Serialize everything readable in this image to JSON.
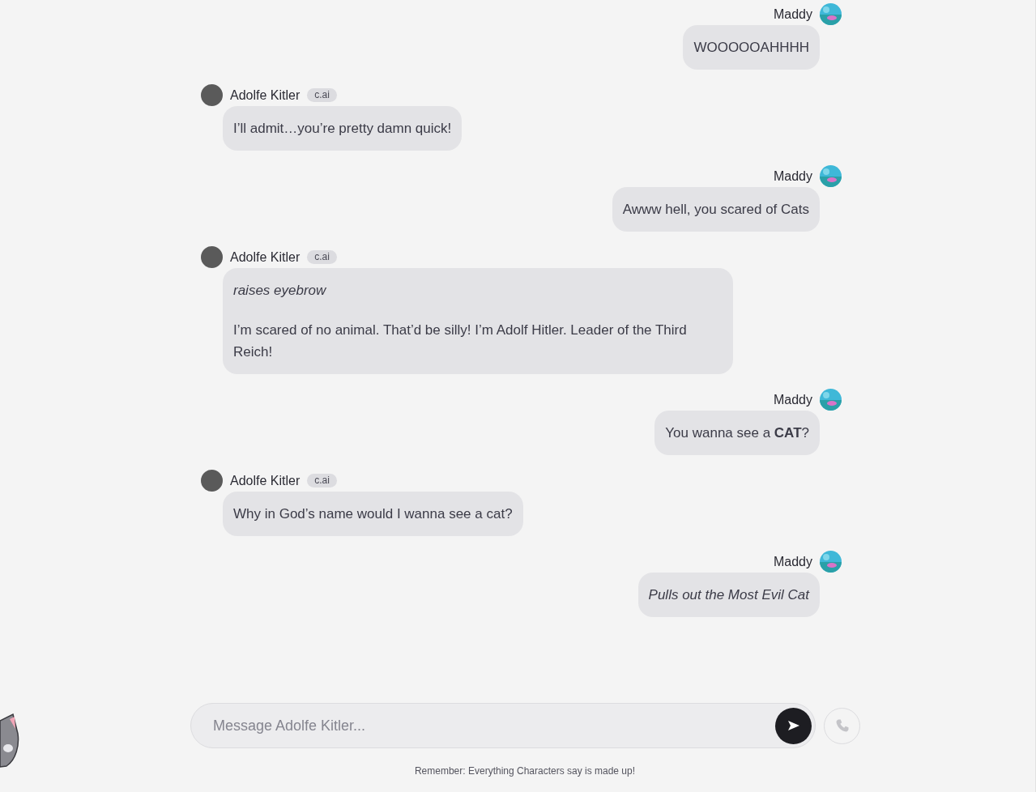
{
  "messages": [
    {
      "sender": "Maddy",
      "kind": "user",
      "paragraphs": [
        {
          "text": "WOOOOOAHHHH",
          "italic": false
        }
      ]
    },
    {
      "sender": "Adolfe Kitler",
      "kind": "bot",
      "badge": "c.ai",
      "paragraphs": [
        {
          "text": "I’ll admit…you’re pretty damn quick!",
          "italic": false
        }
      ]
    },
    {
      "sender": "Maddy",
      "kind": "user",
      "paragraphs": [
        {
          "text": "Awww hell, you scared of Cats",
          "italic": false
        }
      ]
    },
    {
      "sender": "Adolfe Kitler",
      "kind": "bot",
      "badge": "c.ai",
      "paragraphs": [
        {
          "text": "raises eyebrow",
          "italic": true
        },
        {
          "text": "I’m scared of no animal. That’d be silly! I’m Adolf Hitler. Leader of the Third Reich!",
          "italic": false
        }
      ]
    },
    {
      "sender": "Maddy",
      "kind": "user",
      "paragraphs": [
        {
          "text": "You wanna see a **CAT**?",
          "italic": false
        }
      ]
    },
    {
      "sender": "Adolfe Kitler",
      "kind": "bot",
      "badge": "c.ai",
      "paragraphs": [
        {
          "text": "Why in God’s name would I wanna see a cat?",
          "italic": false
        }
      ]
    },
    {
      "sender": "Maddy",
      "kind": "user",
      "paragraphs": [
        {
          "text": "Pulls out the Most Evil Cat",
          "italic": true
        }
      ]
    }
  ],
  "composer": {
    "placeholder": "Message Adolfe Kitler..."
  },
  "disclaimer": "Remember: Everything Characters say is made up!"
}
